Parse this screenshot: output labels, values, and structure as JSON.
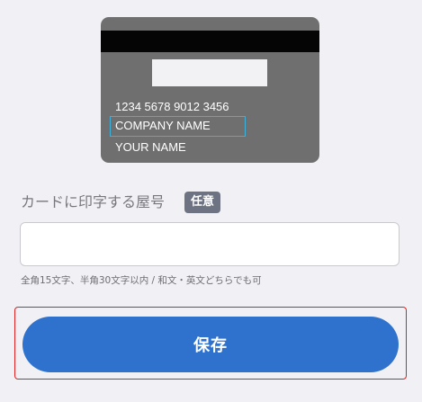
{
  "card": {
    "number": "1234 5678 9012 3456",
    "company_name": "COMPANY NAME",
    "holder_name": "YOUR NAME"
  },
  "form": {
    "label": "カードに印字する屋号",
    "optional_badge": "任意",
    "input_value": "",
    "input_placeholder": "",
    "help_text": "全角15文字、半角30文字以内 / 和文・英文どちらでも可"
  },
  "actions": {
    "save_label": "保存"
  },
  "colors": {
    "primary": "#2f72cd",
    "highlight_border": "#e02020",
    "card_background": "#6f6f6f",
    "company_highlight": "#3bb1dc",
    "badge_background": "#6e7383"
  }
}
